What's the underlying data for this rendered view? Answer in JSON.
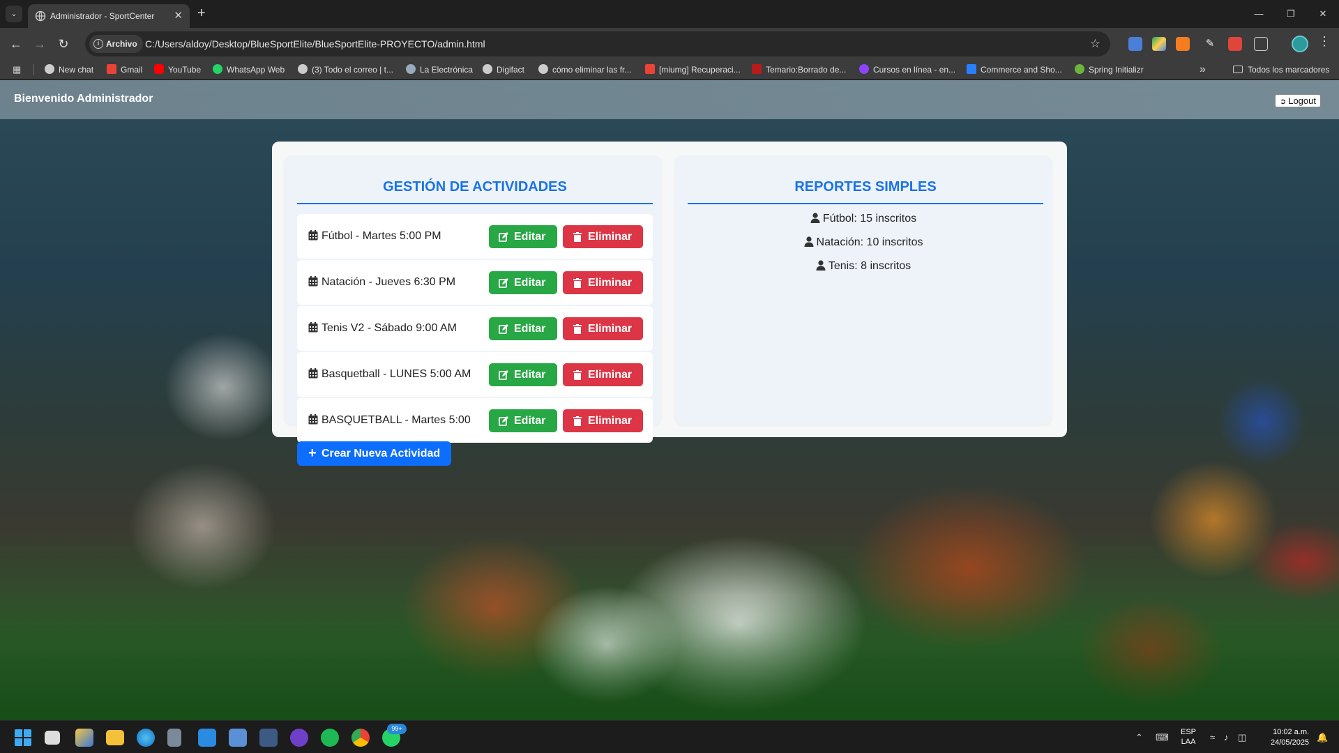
{
  "browser": {
    "tab_title": "Administrador - SportCenter",
    "address_chip": "Archivo",
    "url": "C:/Users/aldoy/Desktop/BlueSportElite/BlueSportElite-PROYECTO/admin.html",
    "bookmarks": [
      "New chat",
      "Gmail",
      "YouTube",
      "WhatsApp Web",
      "(3) Todo el correo | t...",
      "La Electrónica",
      "Digifact",
      "cómo eliminar las fr...",
      "[miumg] Recuperaci...",
      "Temario:Borrado de...",
      "Cursos en línea - en...",
      "Commerce and Sho...",
      "Spring Initializr"
    ],
    "bookmarks_folder": "Todos los marcadores"
  },
  "page": {
    "header_title": "Bienvenido Administrador",
    "logout_label": "Logout",
    "activities_heading": "GESTIÓN DE ACTIVIDADES",
    "reports_heading": "REPORTES SIMPLES",
    "edit_label": "Editar",
    "delete_label": "Eliminar",
    "create_label": "Crear Nueva Actividad",
    "activities": [
      "Fútbol - Martes 5:00 PM",
      "Natación - Jueves 6:30 PM",
      "Tenis V2 - Sábado 9:00 AM",
      "Basquetball - LUNES 5:00 AM",
      "BASQUETBALL - Martes 5:00"
    ],
    "reports": [
      "Fútbol: 15 inscritos",
      "Natación: 10 inscritos",
      "Tenis: 8 inscritos"
    ]
  },
  "taskbar": {
    "language_line1": "ESP",
    "language_line2": "LAA",
    "time": "10:02 a.m.",
    "date": "24/05/2025",
    "whatsapp_badge": "99+"
  },
  "colors": {
    "primary_blue": "#1a73e8",
    "edit_green": "#28a745",
    "delete_red": "#dc3545",
    "create_blue": "#0d6efd"
  }
}
